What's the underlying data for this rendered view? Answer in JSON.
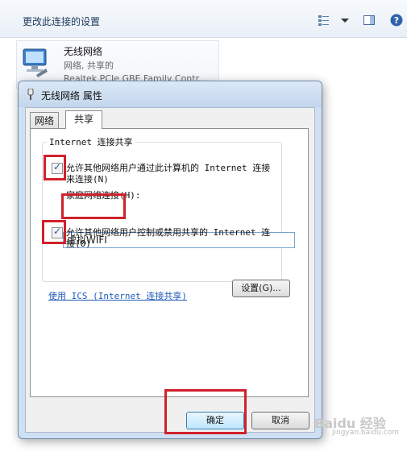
{
  "explorer": {
    "toolbar_title": "更改此连接的设置",
    "adapter": {
      "name": "无线网络",
      "status": "网络, 共享的",
      "device": "Realtek PCIe GBE Family Contr..."
    }
  },
  "dialog": {
    "title": "无线网络 属性",
    "tabs": [
      "网络",
      "共享"
    ],
    "active_tab": "共享",
    "group_label": "Internet 连接共享",
    "option1": {
      "line1": "允许其他网络用户通过此计算机的 Internet 连接",
      "line2": "来连接(N)",
      "checked": true
    },
    "home_network_label": "家庭网络连接(H):",
    "home_network_value": "虚拟WIFI",
    "option2": {
      "line1": "允许其他网络用户控制或禁用共享的 Internet 连",
      "line2": "接(O)",
      "checked": true
    },
    "ics_link": "使用 ICS (Internet 连接共享)",
    "settings_button": "设置(G)...",
    "ok_button": "确定",
    "cancel_button": "取消"
  },
  "watermark": {
    "text": "Baidu 经验",
    "url": "jingyan.baidu.com"
  },
  "colors": {
    "highlight": "#d0212a",
    "link": "#1e5bb8"
  }
}
